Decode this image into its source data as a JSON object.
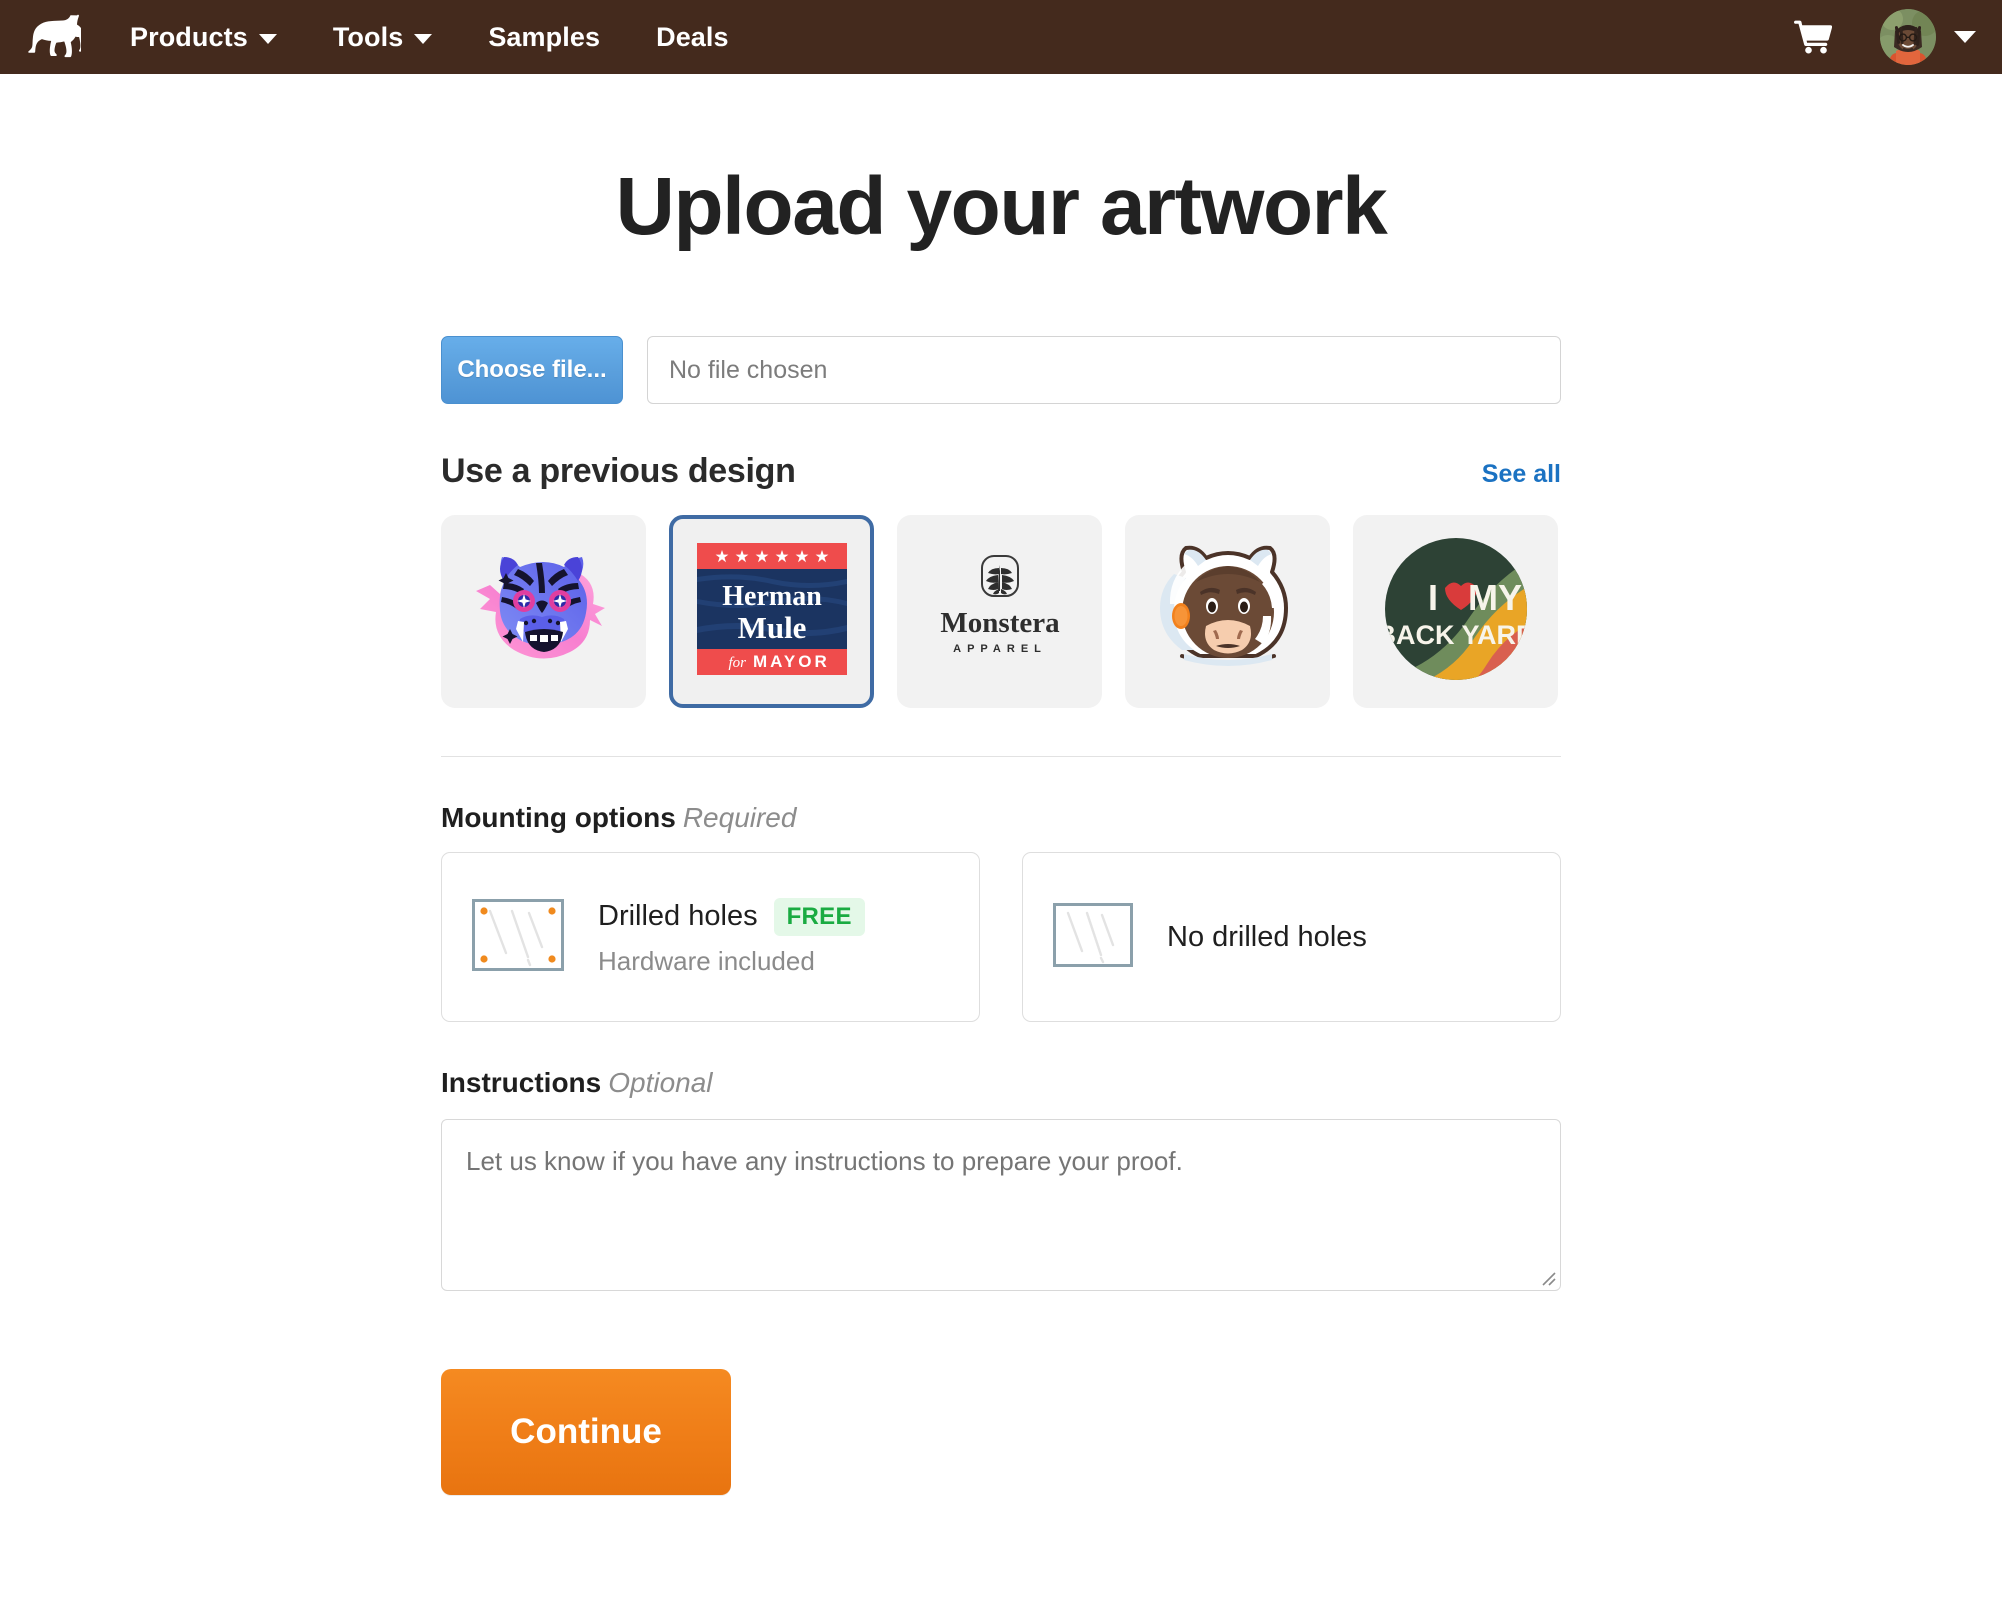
{
  "navbar": {
    "logo_icon": "horse-logo-icon",
    "brand_color": "#442a1d",
    "links": [
      {
        "label": "Products",
        "has_dropdown": true
      },
      {
        "label": "Tools",
        "has_dropdown": true
      },
      {
        "label": "Samples",
        "has_dropdown": false
      },
      {
        "label": "Deals",
        "has_dropdown": false
      }
    ],
    "cart_icon": "shopping-cart-icon",
    "account_icon": "user-avatar",
    "account_caret_icon": "chevron-down-icon"
  },
  "page": {
    "title": "Upload your artwork"
  },
  "file_picker": {
    "button_label": "Choose file...",
    "file_name": "No file chosen",
    "button_color": "#5ba0dd"
  },
  "previous_designs": {
    "heading": "Use a previous design",
    "see_all_label": "See all",
    "see_all_color": "#1b72c2",
    "selected_index": 1,
    "selected_border_color": "#3f6ba4",
    "items": [
      {
        "name": "tiger-sticker",
        "alt": "Blue and purple tiger head sticker with pink outline"
      },
      {
        "name": "herman-mule-sign",
        "alt": "Herman Mule for MAYOR campaign sign",
        "line1": "Herman",
        "line2": "Mule",
        "line3_prefix": "for",
        "line3": "MAYOR"
      },
      {
        "name": "monstera-apparel-logo",
        "alt": "Monstera Apparel logo",
        "line1": "Monstera",
        "line2": "APPAREL"
      },
      {
        "name": "astronaut-mule-sticker",
        "alt": "Mule wearing a white astronaut helmet"
      },
      {
        "name": "i-love-my-backyard-sticker",
        "alt": "I heart my back yard circular sticker",
        "line1": "I",
        "line2": "MY",
        "line3": "BACK YARD"
      }
    ]
  },
  "mounting": {
    "label": "Mounting options",
    "requirement": "Required",
    "options": [
      {
        "title": "Drilled holes",
        "badge": "FREE",
        "badge_color": "#1aab42",
        "badge_bg": "#e4f8e8",
        "subtitle": "Hardware included",
        "icon": "sign-with-drilled-holes-icon"
      },
      {
        "title": "No drilled holes",
        "badge": "",
        "subtitle": "",
        "icon": "plain-sign-icon"
      }
    ]
  },
  "instructions": {
    "label": "Instructions",
    "requirement": "Optional",
    "placeholder": "Let us know if you have any instructions to prepare your proof.",
    "value": ""
  },
  "footer_action": {
    "continue_label": "Continue",
    "continue_color": "#ef7d17"
  }
}
